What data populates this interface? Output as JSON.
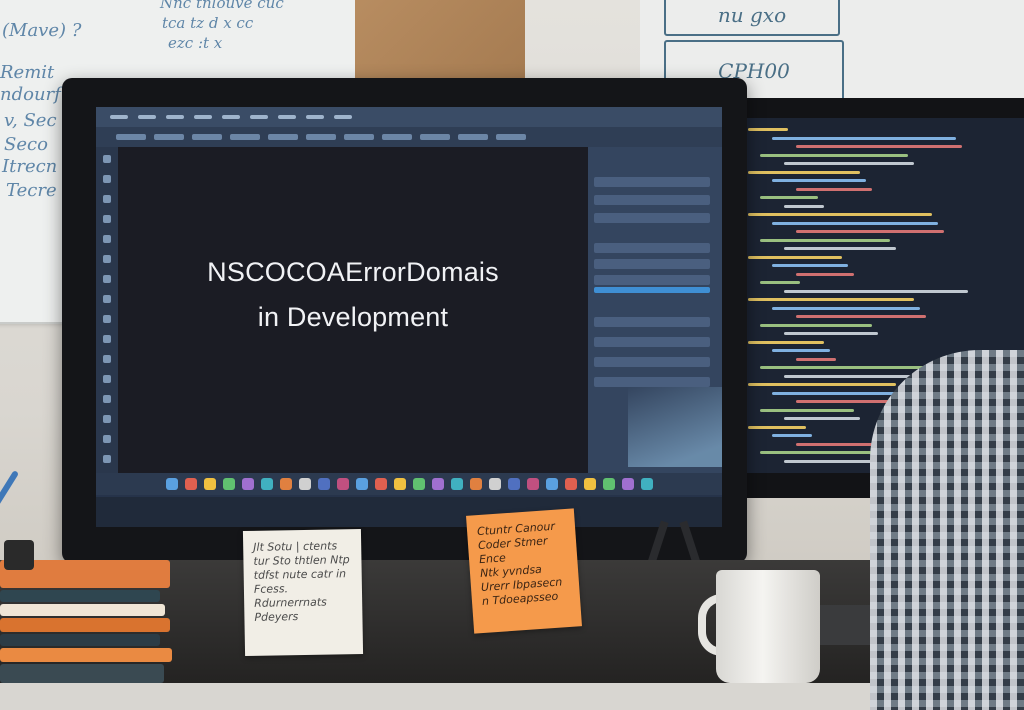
{
  "screen_headline": {
    "line1": "NSCOCOAErrorDomais",
    "line2": "in Development"
  },
  "whiteboard_left": {
    "scribbles": [
      "(Mave) ?",
      "Remit",
      "ndourf",
      "v, Sec",
      "Seco",
      "Itrecn",
      "Tecre",
      "Nnc tnlouve cuc",
      "tca tz d x cc",
      "ezc :t x"
    ]
  },
  "whiteboard_right": {
    "box1": "nu gxo",
    "box2": "CPH00"
  },
  "sticky_note_white": {
    "lines": [
      "Jlt Sotu | ctents",
      "tur Sto thtlen Ntp",
      "tdfst nute catr in",
      "Fcess. Rdurnerrnats",
      "Pdeyers"
    ]
  },
  "sticky_note_orange": {
    "lines": [
      "Ctuntr Canour",
      "Coder Stmer Ence",
      "Ntk yvndsa",
      "Urerr Ibpasecn",
      "n Tdoeapsseo"
    ]
  },
  "colors": {
    "screen_bg": "#1b1c24",
    "ide_panel": "#34455f",
    "accent_blue": "#3f8fd4",
    "sticky_orange": "#f59a4b",
    "sticky_white": "#f1eee6"
  }
}
